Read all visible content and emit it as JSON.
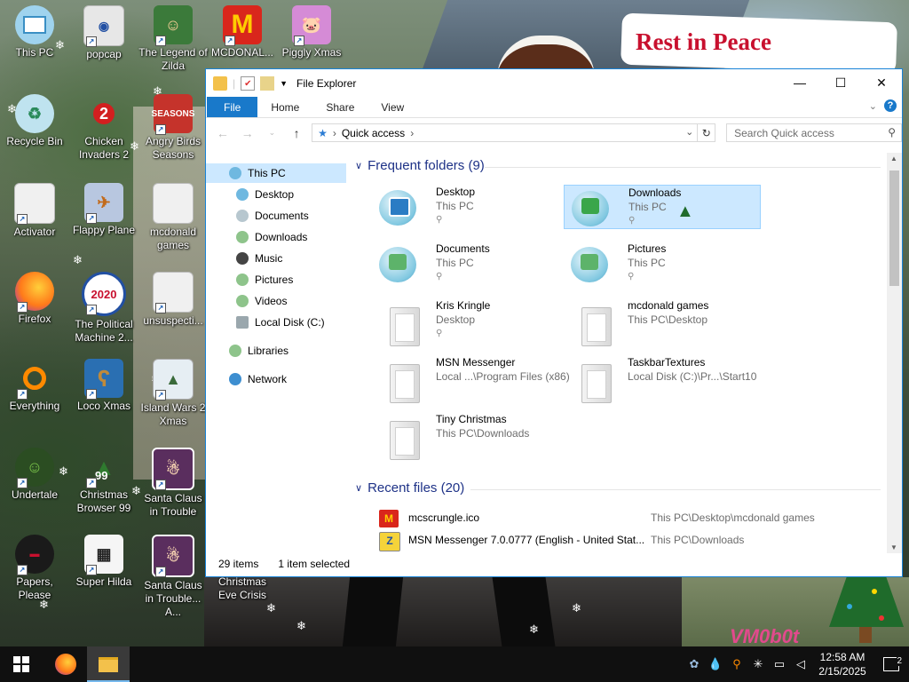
{
  "background": {
    "sign_text": "Rest in Peace",
    "watermark": "VM0b0t"
  },
  "desktop_icons": [
    {
      "id": "this-pc",
      "label": "This PC",
      "color": "#9fd3ee",
      "glyph": "monitor"
    },
    {
      "id": "popcap",
      "label": "popcap",
      "color": "#e7e7e7",
      "glyph": "page"
    },
    {
      "id": "legend-of-zilda",
      "label": "The Legend of Zilda",
      "color": "#3b7a3a",
      "glyph": "character"
    },
    {
      "id": "mcdonalds",
      "label": "MCDONAL...",
      "color": "#d9261c",
      "glyph": "M"
    },
    {
      "id": "piggly-xmas",
      "label": "Piggly Xmas",
      "color": "#d58bd6",
      "glyph": "pig"
    },
    {
      "id": "recycle-bin",
      "label": "Recycle Bin",
      "color": "#bfe3ef",
      "glyph": "recycle"
    },
    {
      "id": "chicken-invaders-2",
      "label": "Chicken Invaders 2",
      "color": "#f2f2f2",
      "glyph": "2"
    },
    {
      "id": "angry-birds-seasons",
      "label": "Angry Birds Seasons",
      "color": "#c5332b",
      "glyph": "bird"
    },
    {
      "id": "activator",
      "label": "Activator",
      "color": "#f0f0f0",
      "glyph": "page"
    },
    {
      "id": "flappy-plane",
      "label": "Flappy Plane",
      "color": "#b8c7e0",
      "glyph": "plane"
    },
    {
      "id": "mcdonald-games-desk",
      "label": "mcdonald games",
      "color": "#f0f0f0",
      "glyph": "folder"
    },
    {
      "id": "firefox",
      "label": "Firefox",
      "color": "#ff7a1a",
      "glyph": "firefox"
    },
    {
      "id": "political-machine",
      "label": "The Political Machine 2...",
      "color": "#2250a3",
      "glyph": "2020"
    },
    {
      "id": "unsuspecting",
      "label": "unsuspecti...",
      "color": "#f0f0f0",
      "glyph": "page"
    },
    {
      "id": "everything",
      "label": "Everything",
      "color": "#ff8a00",
      "glyph": "search"
    },
    {
      "id": "loco-xmas",
      "label": "Loco Xmas",
      "color": "#c08a3a",
      "glyph": "bear"
    },
    {
      "id": "island-wars-2-xmas",
      "label": "Island Wars 2 Xmas",
      "color": "#e6eef3",
      "glyph": "island"
    },
    {
      "id": "undertale",
      "label": "Undertale",
      "color": "#5a8a3a",
      "glyph": "kid"
    },
    {
      "id": "christmas-browser-99",
      "label": "Christmas Browser 99",
      "color": "#2f7a2f",
      "glyph": "99"
    },
    {
      "id": "santa-claus-trouble",
      "label": "Santa Claus in Trouble",
      "color": "#c99b8b",
      "glyph": "santa"
    },
    {
      "id": "papers-please",
      "label": "Papers, Please",
      "color": "#1a1a1a",
      "glyph": "stamp"
    },
    {
      "id": "super-hilda",
      "label": "Super Hilda",
      "color": "#f5f5f5",
      "glyph": "pixel"
    },
    {
      "id": "santa-claus-trouble-a",
      "label": "Santa Claus in Trouble... A...",
      "color": "#c99b8b",
      "glyph": "santa"
    },
    {
      "id": "christmas-eve-crisis",
      "label": "Christmas Eve Crisis",
      "color": "transparent",
      "glyph": "none"
    }
  ],
  "explorer": {
    "title": "File Explorer",
    "tabs": [
      "File",
      "Home",
      "Share",
      "View"
    ],
    "address": {
      "location": "Quick access"
    },
    "search_placeholder": "Search Quick access",
    "nav_pane": [
      {
        "label": "This PC",
        "color": "#6fb8e0"
      },
      {
        "label": "Desktop",
        "color": "#6fb8e0"
      },
      {
        "label": "Documents",
        "color": "#b7c7cf"
      },
      {
        "label": "Downloads",
        "color": "#8ec48b"
      },
      {
        "label": "Music",
        "color": "#444444"
      },
      {
        "label": "Pictures",
        "color": "#8ec48b"
      },
      {
        "label": "Videos",
        "color": "#8ec48b"
      },
      {
        "label": "Local Disk (C:)",
        "color": "#9aa7ad"
      },
      {
        "label": "Libraries",
        "color": "#8ec48b"
      },
      {
        "label": "Network",
        "color": "#3d8ed0"
      }
    ],
    "frequent": {
      "header": "Frequent folders (9)",
      "items": [
        {
          "name": "Desktop",
          "sub": "This PC",
          "pinned": true,
          "icon": "desktop",
          "selected": false
        },
        {
          "name": "Downloads",
          "sub": "This PC",
          "pinned": true,
          "icon": "downloads",
          "selected": true
        },
        {
          "name": "Documents",
          "sub": "This PC",
          "pinned": true,
          "icon": "documents",
          "selected": false
        },
        {
          "name": "Pictures",
          "sub": "This PC",
          "pinned": true,
          "icon": "pictures",
          "selected": false
        },
        {
          "name": "Kris Kringle",
          "sub": "Desktop",
          "pinned": true,
          "icon": "folder",
          "selected": false
        },
        {
          "name": "mcdonald games",
          "sub": "This PC\\Desktop",
          "pinned": false,
          "icon": "folder",
          "selected": false
        },
        {
          "name": "MSN Messenger",
          "sub": "Local ...\\Program Files (x86)",
          "pinned": false,
          "icon": "folder",
          "selected": false
        },
        {
          "name": "TaskbarTextures",
          "sub": "Local Disk (C:)\\Pr...\\Start10",
          "pinned": false,
          "icon": "folder",
          "selected": false
        },
        {
          "name": "Tiny Christmas",
          "sub": "This PC\\Downloads",
          "pinned": false,
          "icon": "folder",
          "selected": false
        }
      ]
    },
    "recent": {
      "header": "Recent files (20)",
      "items": [
        {
          "name": "mcscrungle.ico",
          "path": "This PC\\Desktop\\mcdonald games",
          "color": "#d9261c"
        },
        {
          "name": "MSN Messenger 7.0.0777 (English - United Stat...",
          "path": "This PC\\Downloads",
          "color": "#f5d33a"
        }
      ]
    },
    "status": {
      "count": "29 items",
      "selected": "1 item selected"
    }
  },
  "taskbar": {
    "apps": [
      {
        "id": "firefox",
        "color": "#ff7a1a",
        "active": false
      },
      {
        "id": "file-explorer",
        "color": "#f3c14b",
        "active": true
      }
    ],
    "tray_icons": [
      "people-icon",
      "drop-icon",
      "search-icon",
      "snowflake-icon",
      "network-icon",
      "volume-icon"
    ],
    "time": "12:58 AM",
    "date": "2/15/2025",
    "notifications": "2"
  }
}
